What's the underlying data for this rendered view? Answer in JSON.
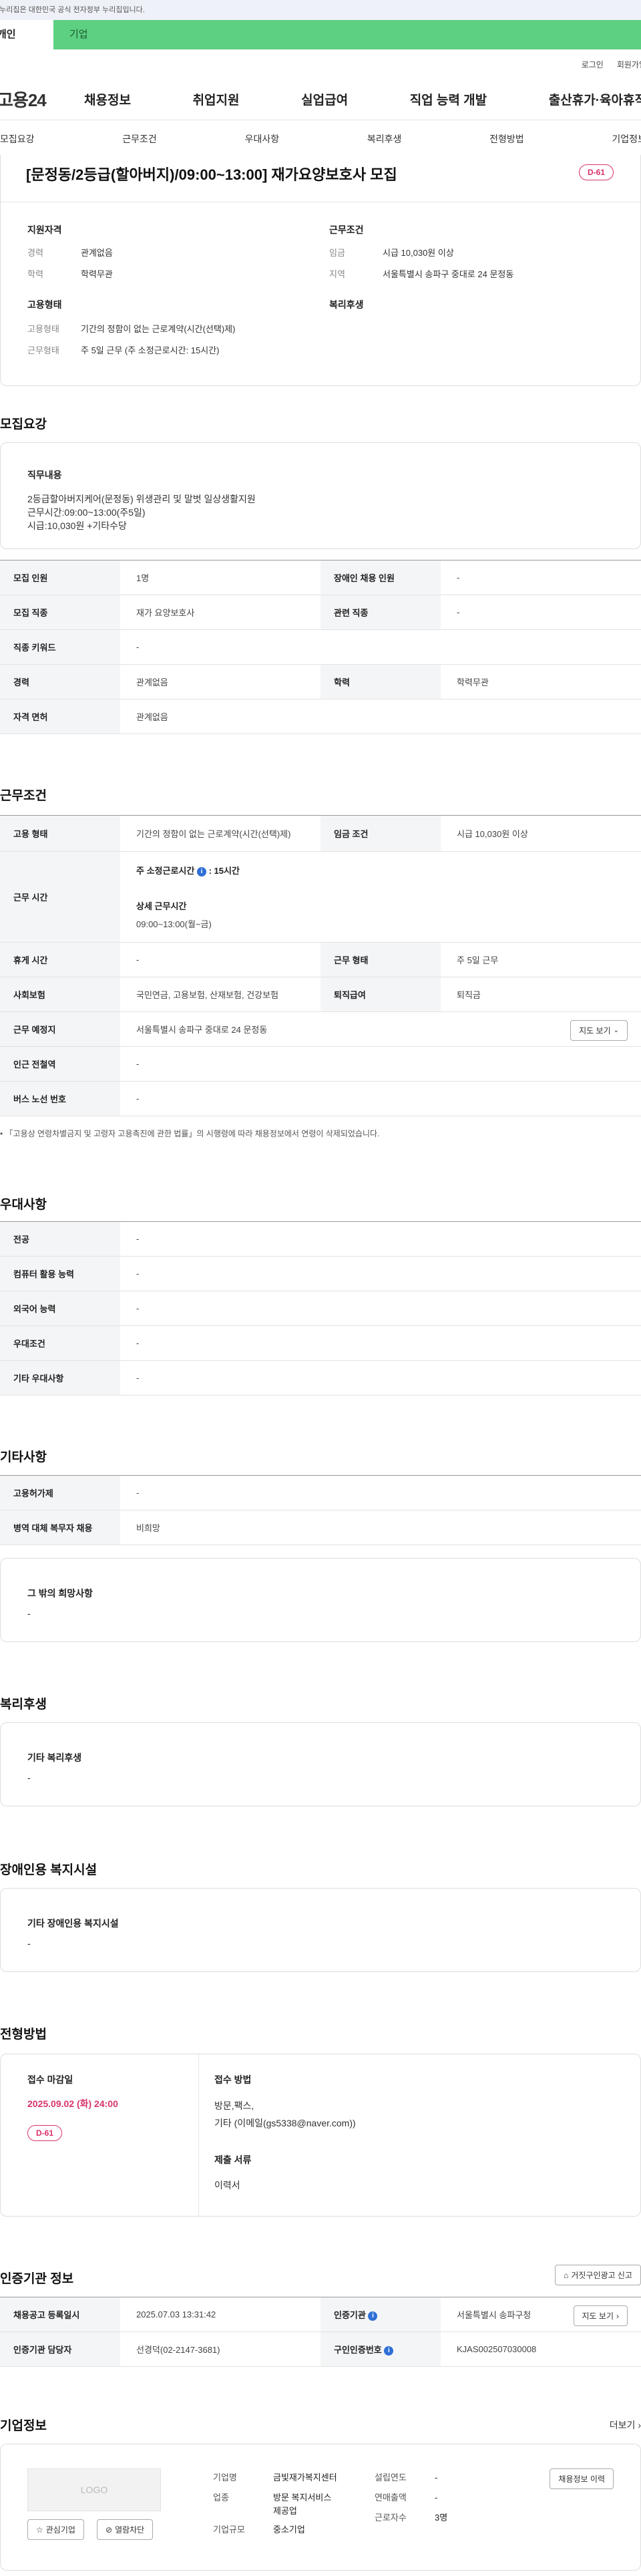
{
  "gov_banner": "이 누리집은 대한민국 공식 전자정부 누리집입니다.",
  "top_tabs": [
    "개인",
    "기업"
  ],
  "util": [
    "로그인",
    "회원가입"
  ],
  "logo": "고용24",
  "gnb": [
    "채용정보",
    "취업지원",
    "실업급여",
    "직업 능력 개발",
    "출산휴가·육아휴직"
  ],
  "subnav": [
    "모집요강",
    "근무조건",
    "우대사항",
    "복리후생",
    "전형방법",
    "기업정보"
  ],
  "header_card": {
    "title": "[문정동/2등급(할아버지)/09:00~13:00] 재가요양보호사 모집",
    "dday": "D-61",
    "qual_title": "지원자격",
    "qual": [
      {
        "k": "경력",
        "v": "관계없음"
      },
      {
        "k": "학력",
        "v": "학력무관"
      }
    ],
    "cond_title": "근무조건",
    "cond": [
      {
        "k": "임금",
        "v": "시급 10,030원 이상"
      },
      {
        "k": "지역",
        "v": "서울특별시 송파구 중대로 24 문정동"
      }
    ],
    "emp_title": "고용형태",
    "emp": [
      {
        "k": "고용형태",
        "v": "기간의 정함이 없는 근로계약(시간(선택)제)"
      },
      {
        "k": "근무형태",
        "v": "주 5일 근무 (주 소정근로시간: 15시간)"
      }
    ],
    "welfare_title": "복리후생"
  },
  "recruit": {
    "title": "모집요강",
    "duty_title": "직무내용",
    "duty_lines": [
      "2등급할아버지케어(문정동)  위생관리 및 말벗 일상생활지원",
      "근무시간:09:00~13:00(주5일)",
      "시급:10,030원 +기타수당"
    ],
    "rows": [
      [
        {
          "k": "모집 인원",
          "v": "1명"
        },
        {
          "k": "장애인 채용 인원",
          "v": "-"
        }
      ],
      [
        {
          "k": "모집 직종",
          "v": "재가 요양보호사"
        },
        {
          "k": "관련 직종",
          "v": "-"
        }
      ],
      [
        {
          "k": "직종 키워드",
          "v": "-"
        }
      ],
      [
        {
          "k": "경력",
          "v": "관계없음"
        },
        {
          "k": "학력",
          "v": "학력무관"
        }
      ],
      [
        {
          "k": "자격 면허",
          "v": "관계없음"
        }
      ]
    ]
  },
  "work": {
    "title": "근무조건",
    "emp_type_k": "고용 형태",
    "emp_type_v": "기간의 정함이 없는 근로계약(시간(선택)제)",
    "wage_k": "임금 조건",
    "wage_v": "시급 10,030원 이상",
    "hours_k": "근무 시간",
    "hours_main_label": "주 소정근로시간",
    "hours_main_value": ": 15시간",
    "hours_detail_label": "상세 근무시간",
    "hours_detail_value": "09:00~13:00(월~금)",
    "rest_k": "휴게 시간",
    "rest_v": "-",
    "form_k": "근무 형태",
    "form_v": "주 5일 근무",
    "ins_k": "사회보험",
    "ins_v": "국민연금, 고용보험, 산재보험, 건강보험",
    "retire_k": "퇴직급여",
    "retire_v": "퇴직금",
    "place_k": "근무 예정지",
    "place_v": "서울특별시 송파구 중대로 24 문정동",
    "map_btn": "지도 보기",
    "subway_k": "인근 전철역",
    "subway_v": "-",
    "bus_k": "버스 노선 번호",
    "bus_v": "-",
    "note": "「고용상 연령차별금지 및 고령자 고용촉진에 관한 법률」의 시행령에 따라 채용정보에서 연령이 삭제되었습니다."
  },
  "pref": {
    "title": "우대사항",
    "rows": [
      {
        "k": "전공",
        "v": "-"
      },
      {
        "k": "컴퓨터 활용 능력",
        "v": "-"
      },
      {
        "k": "외국어 능력",
        "v": "-"
      },
      {
        "k": "우대조건",
        "v": "-"
      },
      {
        "k": "기타 우대사항",
        "v": "-"
      }
    ]
  },
  "etc": {
    "title": "기타사항",
    "rows": [
      {
        "k": "고용허가제",
        "v": "-"
      },
      {
        "k": "병역 대체 복무자 채용",
        "v": "비희망"
      }
    ],
    "card_title": "그 밖의 희망사항",
    "card_value": "-"
  },
  "welfare": {
    "title": "복리후생",
    "card_title": "기타 복리후생",
    "card_value": "-"
  },
  "disabled": {
    "title": "장애인용 복지시설",
    "card_title": "기타 장애인용 복지시설",
    "card_value": "-"
  },
  "selection": {
    "title": "전형방법",
    "deadline_label": "접수 마감일",
    "deadline": "2025.09.02 (화) 24:00",
    "dday": "D-61",
    "method_label": "접수 방법",
    "method_lines": [
      "방문,팩스,",
      "기타 (이메일(gs5338@naver.com))"
    ],
    "docs_label": "제출 서류",
    "docs": "이력서"
  },
  "agency": {
    "title": "인증기관 정보",
    "report_btn": "거짓구인광고 신고",
    "r1": [
      {
        "k": "채용공고 등록일시",
        "v": "2025.07.03 13:31:42"
      },
      {
        "k": "인증기관",
        "v": "서울특별시 송파구청"
      }
    ],
    "r2": [
      {
        "k": "인증기관 담당자",
        "v": "선경덕(02-2147-3681)"
      },
      {
        "k": "구인인증번호",
        "v": "KJAS002507030008"
      }
    ],
    "map_btn": "지도 보기"
  },
  "company": {
    "title": "기업정보",
    "more": "더보기",
    "logo_text": "LOGO",
    "fav_btn": "관심기업",
    "block_btn": "열람차단",
    "history_btn": "채용정보 이력",
    "name_k": "기업명",
    "name_v": "금빛재가복지센터",
    "ind_k": "업종",
    "ind_v1": "방문 복지서비스",
    "ind_v2": "제공업",
    "size_k": "기업규모",
    "size_v": "중소기업",
    "year_k": "설립연도",
    "year_v": "-",
    "sales_k": "연매출액",
    "sales_v": "-",
    "staff_k": "근로자수",
    "staff_v": "3명"
  }
}
